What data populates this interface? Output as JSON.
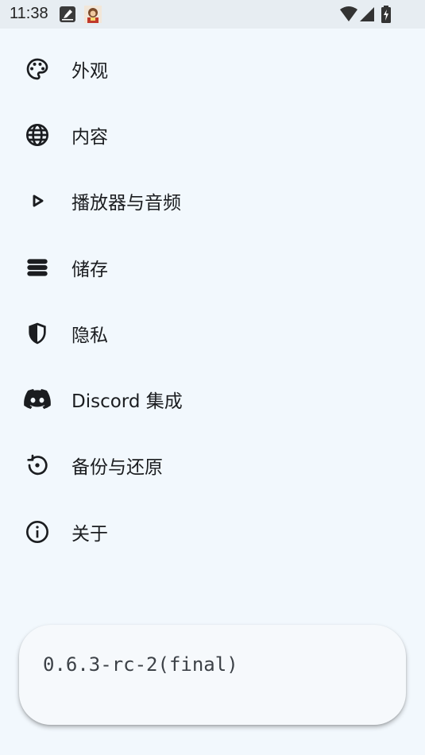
{
  "status_bar": {
    "time": "11:38",
    "icons": [
      "edit-note-icon",
      "app-avatar-icon",
      "wifi-icon",
      "cell-signal-icon",
      "battery-charging-icon"
    ]
  },
  "settings": {
    "items": [
      {
        "label": "外观",
        "icon": "palette-icon"
      },
      {
        "label": "内容",
        "icon": "globe-icon"
      },
      {
        "label": "播放器与音频",
        "icon": "play-icon"
      },
      {
        "label": "储存",
        "icon": "storage-icon"
      },
      {
        "label": "隐私",
        "icon": "shield-icon"
      },
      {
        "label": "Discord 集成",
        "icon": "discord-icon"
      },
      {
        "label": "备份与还原",
        "icon": "restore-icon"
      },
      {
        "label": "关于",
        "icon": "info-icon"
      }
    ]
  },
  "version": {
    "text": "0.6.3-rc-2(final)"
  },
  "colors": {
    "background": "#f2f8fd",
    "status_bar": "#e7edf2",
    "text": "#1b1d20",
    "icon": "#1b1d20"
  }
}
